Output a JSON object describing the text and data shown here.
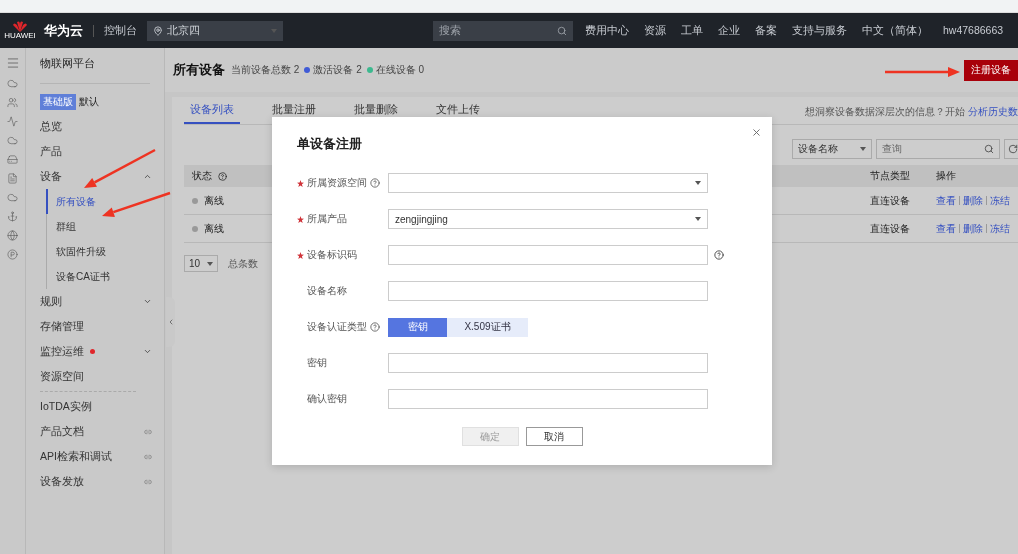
{
  "topnav": {
    "logo_text": "HUAWEI",
    "brand": "华为云",
    "console": "控制台",
    "region": "北京四",
    "search_placeholder": "搜索",
    "links": [
      "费用中心",
      "资源",
      "工单",
      "企业",
      "备案",
      "支持与服务",
      "中文（简体）",
      "hw47686663"
    ]
  },
  "sidebar": {
    "title": "物联网平台",
    "edition_badge": "基础版",
    "edition": "默认",
    "items": [
      {
        "label": "总览",
        "kind": "plain",
        "alert": false
      },
      {
        "label": "产品",
        "kind": "plain",
        "alert": false
      },
      {
        "label": "设备",
        "kind": "group",
        "expanded": true,
        "alert": false,
        "children": [
          {
            "label": "所有设备",
            "selected": true
          },
          {
            "label": "群组",
            "selected": false
          },
          {
            "label": "软固件升级",
            "selected": false
          },
          {
            "label": "设备CA证书",
            "selected": false
          }
        ]
      },
      {
        "label": "规则",
        "kind": "group",
        "expanded": false,
        "alert": false
      },
      {
        "label": "存储管理",
        "kind": "plain",
        "alert": false
      },
      {
        "label": "监控运维",
        "kind": "group",
        "expanded": false,
        "alert": true
      },
      {
        "label": "资源空间",
        "kind": "plain",
        "alert": false
      }
    ],
    "extra_items": [
      {
        "label": "IoTDA实例",
        "kind": "plain"
      },
      {
        "label": "产品文档",
        "kind": "link"
      },
      {
        "label": "API检索和调试",
        "kind": "link"
      },
      {
        "label": "设备发放",
        "kind": "link"
      }
    ]
  },
  "page": {
    "title": "所有设备",
    "stats": [
      {
        "label": "当前设备总数",
        "value": "2"
      },
      {
        "label": "激活设备",
        "value": "2",
        "color": "#3f5bd6"
      },
      {
        "label": "在线设备",
        "value": "0",
        "color": "#3cb98f"
      }
    ],
    "register_button": "注册设备"
  },
  "tabs": [
    {
      "label": "设备列表",
      "selected": true
    },
    {
      "label": "批量注册",
      "selected": false
    },
    {
      "label": "批量删除",
      "selected": false
    },
    {
      "label": "文件上传",
      "selected": false
    }
  ],
  "insight": {
    "text": "想洞察设备数据深层次的信息？开始",
    "link": "分析历史数"
  },
  "filter": {
    "field": "设备名称",
    "placeholder": "查询"
  },
  "table": {
    "columns": [
      "状态",
      "节点类型",
      "操作"
    ],
    "rows": [
      {
        "status": "离线",
        "node_type": "直连设备",
        "actions": [
          "查看",
          "删除",
          "冻结"
        ]
      },
      {
        "status": "离线",
        "node_type": "直连设备",
        "actions": [
          "查看",
          "删除",
          "冻结"
        ]
      }
    ]
  },
  "pagination": {
    "page_size": "10",
    "total_label": "总条数"
  },
  "modal": {
    "title": "单设备注册",
    "fields": [
      {
        "label": "所属资源空间",
        "required": true,
        "label_help": true,
        "field_help": false,
        "kind": "select"
      },
      {
        "label": "所属产品",
        "required": true,
        "label_help": false,
        "field_help": false,
        "kind": "select",
        "value": "zengjingjing"
      },
      {
        "label": "设备标识码",
        "required": true,
        "label_help": false,
        "field_help": true,
        "kind": "input"
      },
      {
        "label": "设备名称",
        "required": false,
        "label_help": false,
        "field_help": false,
        "kind": "input"
      },
      {
        "label": "设备认证类型",
        "required": false,
        "label_help": true,
        "field_help": false,
        "kind": "toggle",
        "options": [
          {
            "label": "密钥",
            "selected": true
          },
          {
            "label": "X.509证书",
            "selected": false
          }
        ]
      },
      {
        "label": "密钥",
        "required": false,
        "label_help": false,
        "field_help": false,
        "kind": "input"
      },
      {
        "label": "确认密钥",
        "required": false,
        "label_help": false,
        "field_help": false,
        "kind": "input"
      }
    ],
    "buttons": [
      {
        "label": "确定",
        "disabled": true
      },
      {
        "label": "取消",
        "disabled": false
      }
    ]
  }
}
